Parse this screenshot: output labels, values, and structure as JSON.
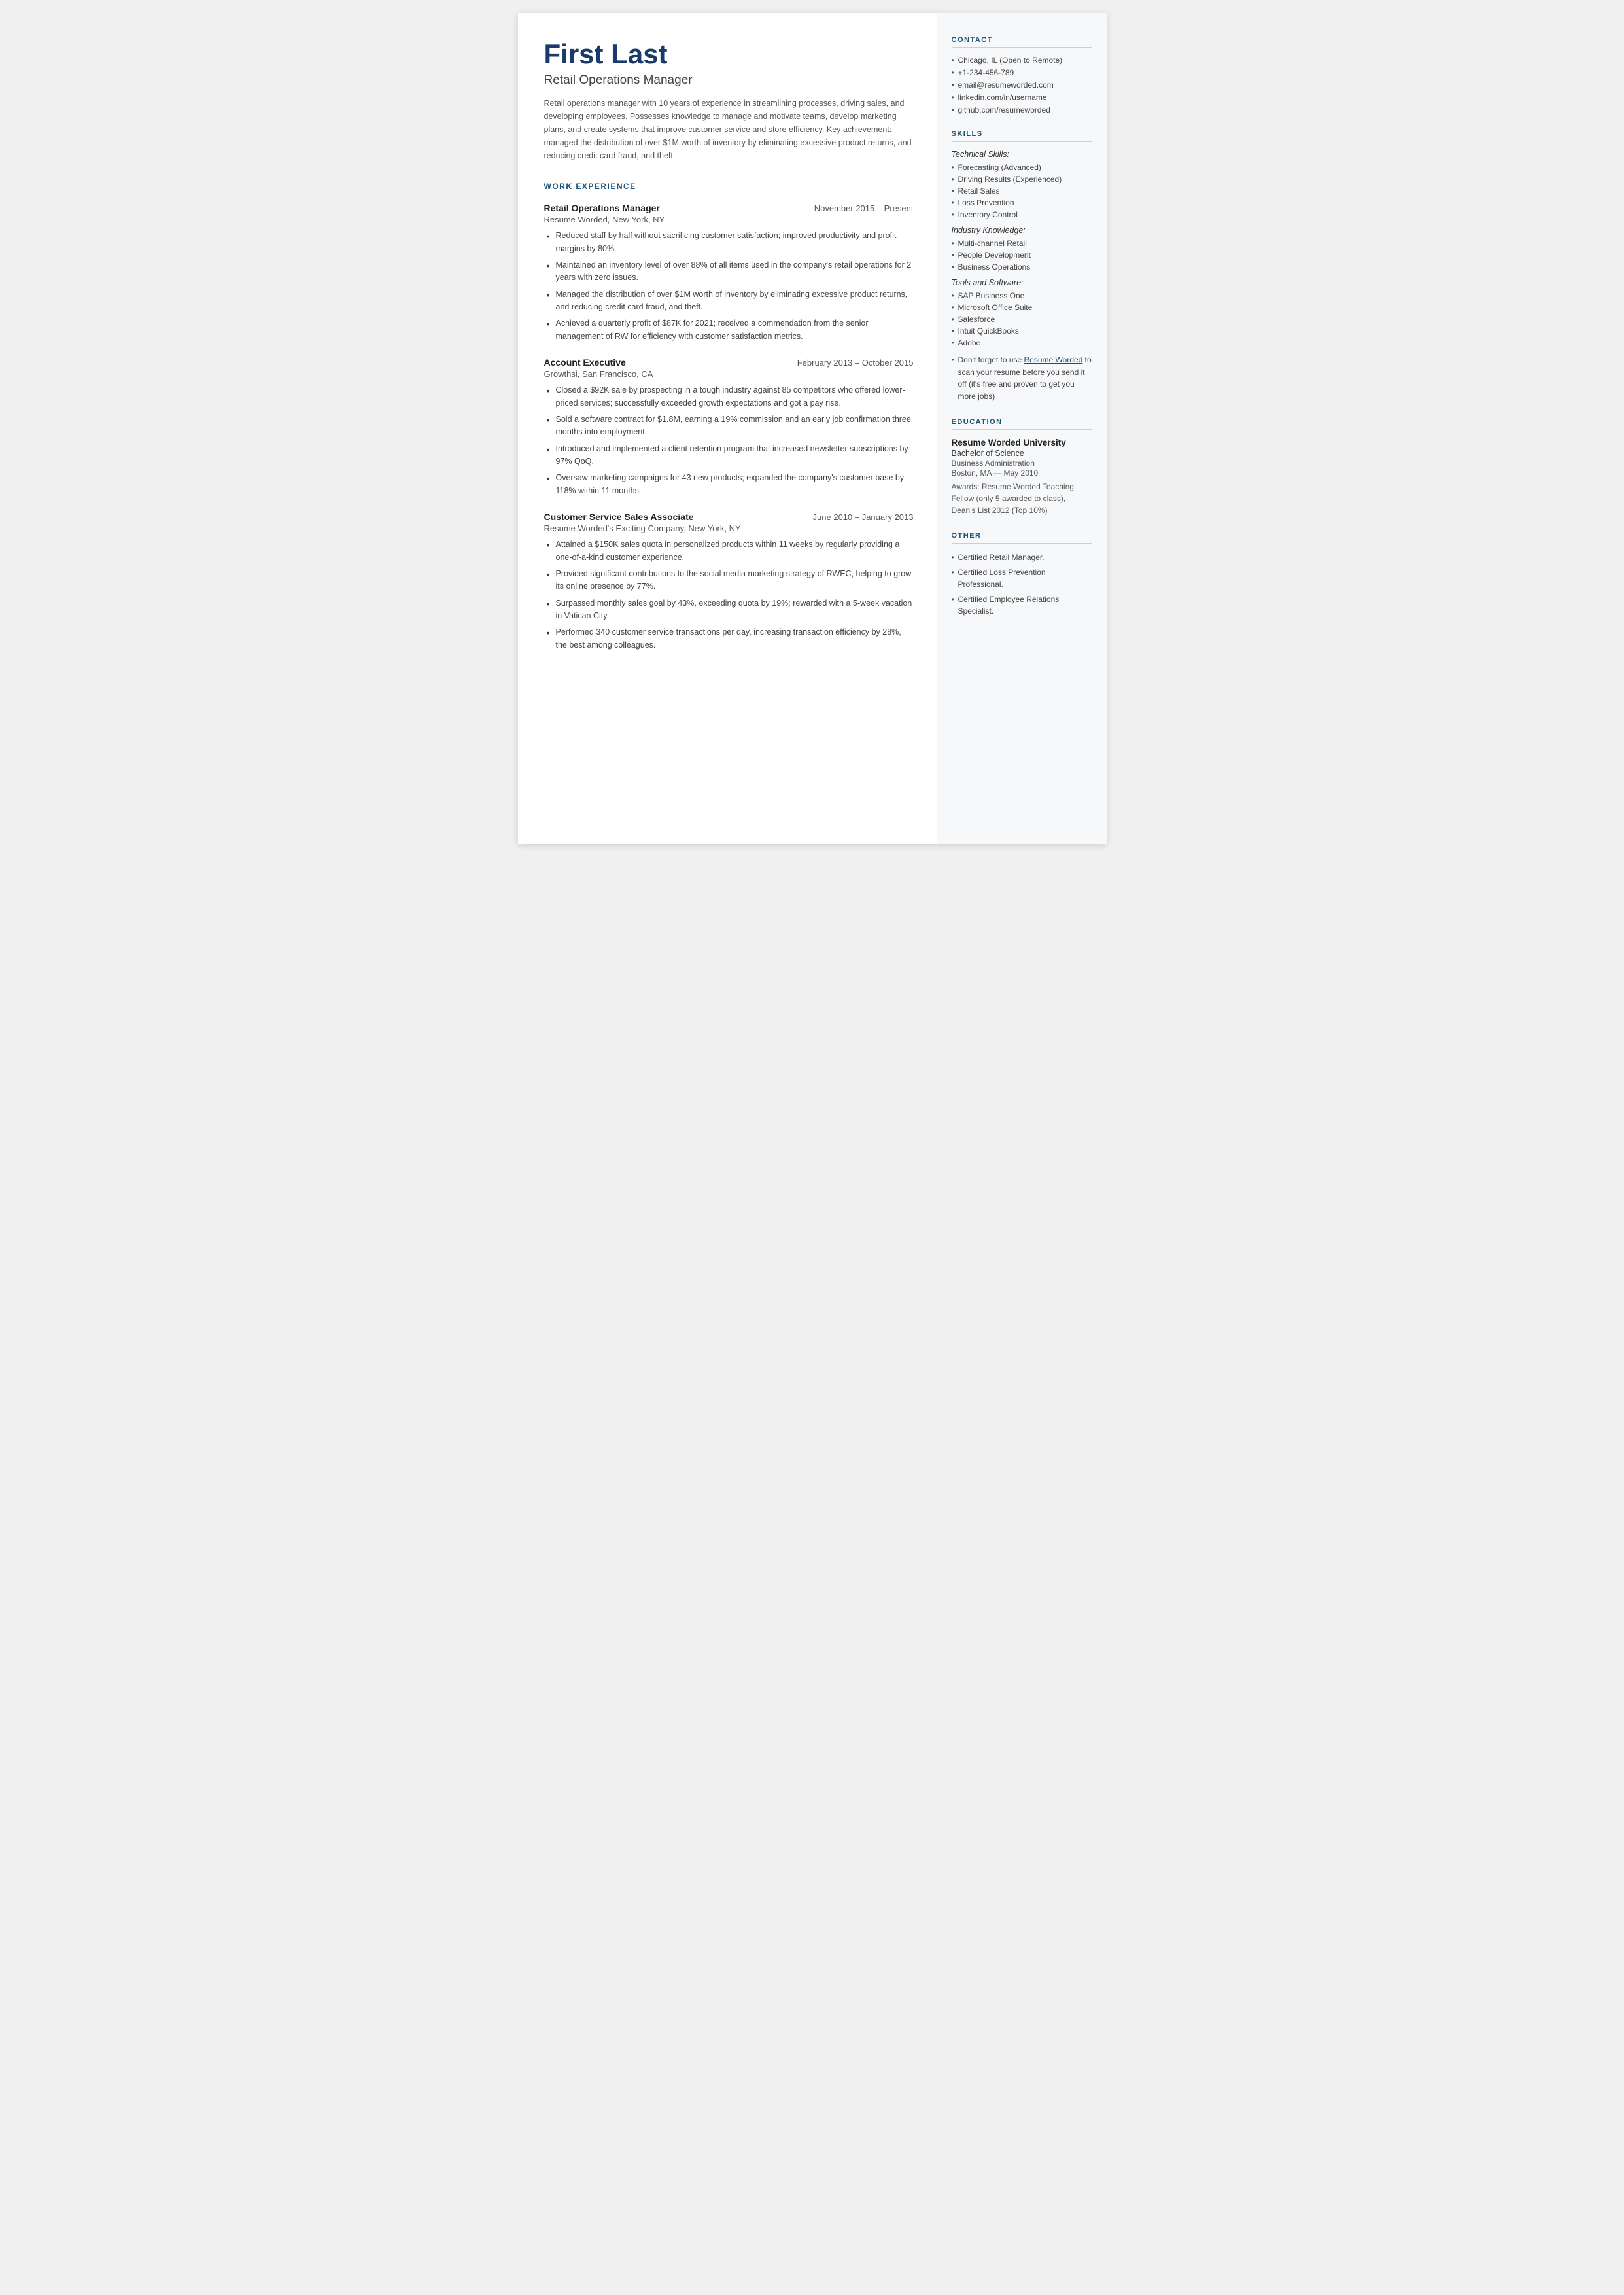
{
  "header": {
    "name": "First Last",
    "title": "Retail Operations Manager",
    "summary": "Retail operations manager with 10 years of experience in streamlining processes, driving sales, and developing employees. Possesses knowledge to manage and motivate teams, develop marketing plans, and create systems that improve customer service and store efficiency. Key achievement: managed the distribution of over $1M worth of inventory by eliminating excessive product returns, and reducing credit card fraud, and theft."
  },
  "sections": {
    "work_experience_label": "WORK EXPERIENCE",
    "jobs": [
      {
        "title": "Retail Operations Manager",
        "dates": "November 2015 – Present",
        "company": "Resume Worded, New York, NY",
        "bullets": [
          "Reduced staff by half without sacrificing customer satisfaction; improved productivity and profit margins by 80%.",
          "Maintained an inventory level of over 88% of all items used in the company's retail operations for 2 years with zero issues.",
          "Managed the distribution of over $1M worth of inventory by eliminating excessive product returns, and reducing credit card fraud, and theft.",
          "Achieved a quarterly profit of $87K for 2021; received a commendation from the senior management of RW for efficiency with customer satisfaction metrics."
        ]
      },
      {
        "title": "Account Executive",
        "dates": "February 2013 – October 2015",
        "company": "Growthsi, San Francisco, CA",
        "bullets": [
          "Closed a $92K sale by prospecting in a tough industry against 85 competitors who offered lower-priced services; successfully exceeded growth expectations and got a pay rise.",
          "Sold a software contract for $1.8M, earning a 19% commission and an early job confirmation three months into employment.",
          "Introduced and implemented a client retention program that increased newsletter subscriptions by 97% QoQ.",
          "Oversaw marketing campaigns for 43 new products; expanded the company's customer base by 118% within 11 months."
        ]
      },
      {
        "title": "Customer Service Sales Associate",
        "dates": "June 2010 – January 2013",
        "company": "Resume Worded's Exciting Company, New York, NY",
        "bullets": [
          "Attained a $150K sales quota in personalized products within 11 weeks by regularly providing a one-of-a-kind customer experience.",
          "Provided significant contributions to the social media marketing strategy of RWEC, helping to grow its online presence by 77%.",
          "Surpassed monthly sales goal by 43%, exceeding quota by 19%; rewarded with a 5-week vacation in Vatican City.",
          "Performed 340 customer service transactions per day, increasing transaction efficiency by 28%, the best among colleagues."
        ]
      }
    ]
  },
  "sidebar": {
    "contact_label": "CONTACT",
    "contact_items": [
      "Chicago, IL (Open to Remote)",
      "+1-234-456-789",
      "email@resumeworded.com",
      "linkedin.com/in/username",
      "github.com/resumeworded"
    ],
    "skills_label": "SKILLS",
    "skills_categories": [
      {
        "title": "Technical Skills:",
        "items": [
          "Forecasting (Advanced)",
          "Driving Results (Experienced)",
          "Retail Sales",
          "Loss Prevention",
          "Inventory Control"
        ]
      },
      {
        "title": "Industry Knowledge:",
        "items": [
          "Multi-channel Retail",
          "People Development",
          "Business Operations"
        ]
      },
      {
        "title": "Tools and Software:",
        "items": [
          "SAP Business One",
          "Microsoft Office Suite",
          "Salesforce",
          "Intuit QuickBooks",
          "Adobe"
        ]
      }
    ],
    "rw_note": "Don't forget to use Resume Worded to scan your resume before you send it off (it's free and proven to get you more jobs)",
    "rw_link_text": "Resume Worded",
    "education_label": "EDUCATION",
    "education": {
      "school": "Resume Worded University",
      "degree": "Bachelor of Science",
      "field": "Business Administration",
      "location": "Boston, MA — May 2010",
      "awards": "Awards: Resume Worded Teaching Fellow (only 5 awarded to class), Dean's List 2012 (Top 10%)"
    },
    "other_label": "OTHER",
    "other_items": [
      "Certified Retail Manager.",
      "Certified Loss Prevention Professional.",
      "Certified Employee Relations Specialist."
    ]
  }
}
